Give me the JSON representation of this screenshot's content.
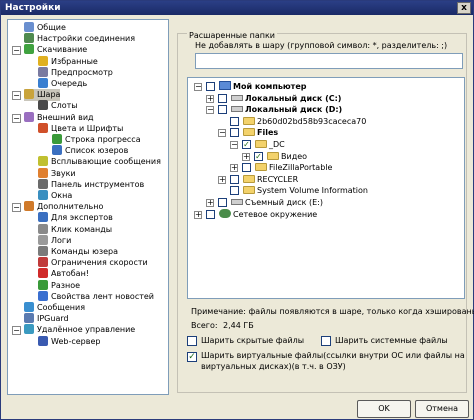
{
  "window": {
    "title": "Настройки",
    "close_glyph": "x"
  },
  "sidebar": {
    "items": [
      {
        "label": "Общие",
        "icon": "general-icon",
        "color": "#6a8fcf",
        "indent": 0,
        "expander": ""
      },
      {
        "label": "Настройки соединения",
        "icon": "network-icon",
        "color": "#4f8a4f",
        "indent": 0,
        "expander": ""
      },
      {
        "label": "Скачивание",
        "icon": "download-icon",
        "color": "#3fa23f",
        "indent": 0,
        "expander": "−"
      },
      {
        "label": "Избранные",
        "icon": "star-icon",
        "color": "#e0b020",
        "indent": 1,
        "expander": ""
      },
      {
        "label": "Предпросмотр",
        "icon": "preview-icon",
        "color": "#7a7aa0",
        "indent": 1,
        "expander": ""
      },
      {
        "label": "Очередь",
        "icon": "queue-icon",
        "color": "#3a7fd0",
        "indent": 1,
        "expander": ""
      },
      {
        "label": "Шара",
        "icon": "share-icon",
        "color": "#c9a33a",
        "indent": 0,
        "expander": "−",
        "selected": true
      },
      {
        "label": "Слоты",
        "icon": "slots-icon",
        "color": "#4a4a4a",
        "indent": 1,
        "expander": ""
      },
      {
        "label": "Внешний вид",
        "icon": "appearance-icon",
        "color": "#9a6fc0",
        "indent": 0,
        "expander": "−"
      },
      {
        "label": "Цвета и Шрифты",
        "icon": "palette-icon",
        "color": "#d0502a",
        "indent": 1,
        "expander": ""
      },
      {
        "label": "Строка прогресса",
        "icon": "progress-icon",
        "color": "#3a9a3a",
        "indent": 2,
        "expander": ""
      },
      {
        "label": "Список юзеров",
        "icon": "users-icon",
        "color": "#3a6fc0",
        "indent": 2,
        "expander": ""
      },
      {
        "label": "Всплывающие сообщения",
        "icon": "popup-icon",
        "color": "#c0c030",
        "indent": 1,
        "expander": ""
      },
      {
        "label": "Звуки",
        "icon": "sound-icon",
        "color": "#e08030",
        "indent": 1,
        "expander": ""
      },
      {
        "label": "Панель инструментов",
        "icon": "toolbar-icon",
        "color": "#6a6a6a",
        "indent": 1,
        "expander": ""
      },
      {
        "label": "Окна",
        "icon": "windows-icon",
        "color": "#3a8fc0",
        "indent": 1,
        "expander": ""
      },
      {
        "label": "Дополнительно",
        "icon": "advanced-icon",
        "color": "#d07a2a",
        "indent": 0,
        "expander": "−"
      },
      {
        "label": "Для экспертов",
        "icon": "expert-icon",
        "color": "#3a6fc0",
        "indent": 1,
        "expander": ""
      },
      {
        "label": "Клик команды",
        "icon": "command-icon",
        "color": "#8a8a8a",
        "indent": 1,
        "expander": ""
      },
      {
        "label": "Логи",
        "icon": "logs-icon",
        "color": "#9a9a9a",
        "indent": 1,
        "expander": ""
      },
      {
        "label": "Команды юзера",
        "icon": "user-commands-icon",
        "color": "#7a7a7a",
        "indent": 1,
        "expander": ""
      },
      {
        "label": "Ограничения скорости",
        "icon": "speed-icon",
        "color": "#c03a3a",
        "indent": 1,
        "expander": ""
      },
      {
        "label": "Автобан!",
        "icon": "ban-icon",
        "color": "#d02a2a",
        "indent": 1,
        "expander": ""
      },
      {
        "label": "Разное",
        "icon": "misc-icon",
        "color": "#3a9a3a",
        "indent": 1,
        "expander": ""
      },
      {
        "label": "Свойства лент новостей",
        "icon": "rss-icon",
        "color": "#3a6fd0",
        "indent": 1,
        "expander": ""
      },
      {
        "label": "Сообщения",
        "icon": "messages-icon",
        "color": "#3a8fd0",
        "indent": 0,
        "expander": ""
      },
      {
        "label": "IPGuard",
        "icon": "ipguard-icon",
        "color": "#5a7ab0",
        "indent": 0,
        "expander": ""
      },
      {
        "label": "Удалённое управление",
        "icon": "remote-icon",
        "color": "#3a9ac0",
        "indent": 0,
        "expander": "−"
      },
      {
        "label": "Web-сервер",
        "icon": "webserver-icon",
        "color": "#3a5ab0",
        "indent": 1,
        "expander": ""
      }
    ]
  },
  "share": {
    "group_title": "Расшаренные папки",
    "exclude_label": "Не добавлять в шару (групповой символ: *, разделитель: ;)",
    "exclude_value": "",
    "tree": [
      {
        "label": "Мой компьютер",
        "type": "pc",
        "depth": 0,
        "expander": "−",
        "check": "",
        "bold": true
      },
      {
        "label": "Локальный диск (C:)",
        "type": "drive",
        "depth": 1,
        "expander": "+",
        "check": "",
        "bold": true
      },
      {
        "label": "Локальный диск (D:)",
        "type": "drive",
        "depth": 1,
        "expander": "−",
        "check": "",
        "bold": true
      },
      {
        "label": "2b60d02bd58b93caceca70",
        "type": "folder",
        "depth": 2,
        "expander": "",
        "check": "",
        "bold": false
      },
      {
        "label": "Files",
        "type": "folder",
        "depth": 2,
        "expander": "−",
        "check": "",
        "bold": true
      },
      {
        "label": "_DC",
        "type": "folder",
        "depth": 3,
        "expander": "−",
        "check": "✓",
        "bold": false
      },
      {
        "label": "Видео",
        "type": "folder",
        "depth": 4,
        "expander": "+",
        "check": "✓",
        "bold": false
      },
      {
        "label": "FileZillaPortable",
        "type": "folder",
        "depth": 3,
        "expander": "+",
        "check": "",
        "bold": false
      },
      {
        "label": "RECYCLER",
        "type": "folder",
        "depth": 2,
        "expander": "+",
        "check": "",
        "bold": false
      },
      {
        "label": "System Volume Information",
        "type": "folder",
        "depth": 2,
        "expander": "",
        "check": "",
        "bold": false
      },
      {
        "label": "Съемный диск (E:)",
        "type": "drive",
        "depth": 1,
        "expander": "+",
        "check": "",
        "bold": false
      },
      {
        "label": "Сетевое окружение",
        "type": "net",
        "depth": 0,
        "expander": "+",
        "check": "",
        "bold": false
      }
    ],
    "note": "Примечание: файлы появляются в шаре, только когда хэшированы!",
    "total_label": "Всего:",
    "total_value": "2,44 ГБ",
    "options": {
      "hidden_label": "Шарить скрытые файлы",
      "hidden_checked": false,
      "system_label": "Шарить системные файлы",
      "system_checked": false,
      "virtual_label_1": "Шарить виртуальные файлы(ссылки внутри ОС или файлы на",
      "virtual_label_2": "виртуальных дисках)(в т.ч. в ОЗУ)",
      "virtual_checked": true
    }
  },
  "buttons": {
    "ok": "OK",
    "cancel": "Отмена"
  }
}
